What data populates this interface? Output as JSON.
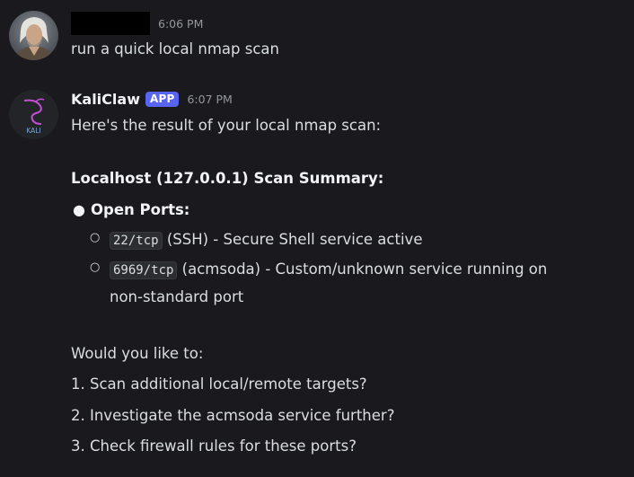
{
  "message_user": {
    "timestamp": "6:06 PM",
    "text": "run a quick local nmap scan"
  },
  "message_bot": {
    "username": "KaliClaw",
    "badge": "APP",
    "timestamp": "6:07 PM",
    "avatar_label": "KALI",
    "intro": "Here's the result of your local nmap scan:",
    "summary_heading": "Localhost (127.0.0.1) Scan Summary:",
    "open_ports_label": "Open Ports:",
    "ports": [
      {
        "code": "22/tcp",
        "description": " (SSH) - Secure Shell service active"
      },
      {
        "code": "6969/tcp",
        "description": " (acmsoda) - Custom/unknown service running on",
        "continuation": "non-standard port"
      }
    ],
    "question": "Would you like to:",
    "options": [
      "1. Scan additional local/remote targets?",
      "2. Investigate the acmsoda service further?",
      "3. Check firewall rules for these ports?"
    ]
  },
  "colors": {
    "background": "#1a1a1e",
    "text": "#dbdee1",
    "timestamp": "#94979e",
    "badge": "#5865f2",
    "kali_accent": "#c44fd6"
  }
}
